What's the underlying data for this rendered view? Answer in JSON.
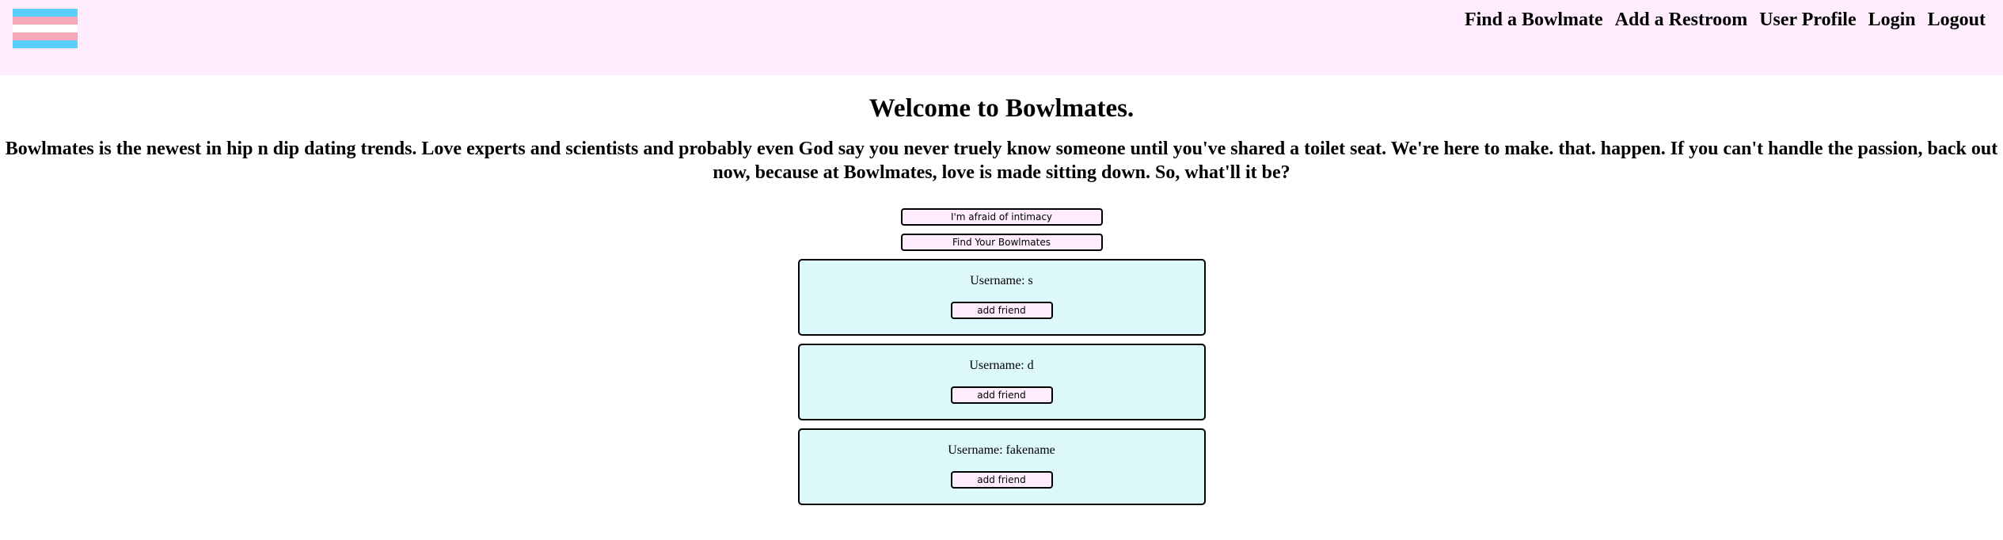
{
  "header": {
    "logo_icon": "trans-flag-icon",
    "colors": {
      "background": "#ffedfd",
      "flag_blue": "#5bcefa",
      "flag_pink": "#f5a9b8",
      "flag_white": "#ffffff"
    },
    "nav": [
      {
        "label": "Find a Bowlmate"
      },
      {
        "label": "Add a Restroom"
      },
      {
        "label": "User Profile"
      },
      {
        "label": "Login"
      },
      {
        "label": "Logout"
      }
    ]
  },
  "main": {
    "title": "Welcome to Bowlmates.",
    "intro": "Bowlmates is the newest in hip n dip dating trends. Love experts and scientists and probably even God say you never truely know someone until you've shared a toilet seat. We're here to make. that. happen. If you can't handle the passion, back out now, because at Bowlmates, love is made sitting down. So, what'll it be?",
    "buttons": {
      "afraid": "I'm afraid of intimacy",
      "find": "Find Your Bowlmates"
    },
    "users": [
      {
        "username": "Username: s",
        "action": "add friend"
      },
      {
        "username": "Username: d",
        "action": "add friend"
      },
      {
        "username": "Username: fakename",
        "action": "add friend"
      }
    ],
    "colors": {
      "card_background": "#dcf8fb",
      "button_background": "#ffedfd"
    }
  }
}
